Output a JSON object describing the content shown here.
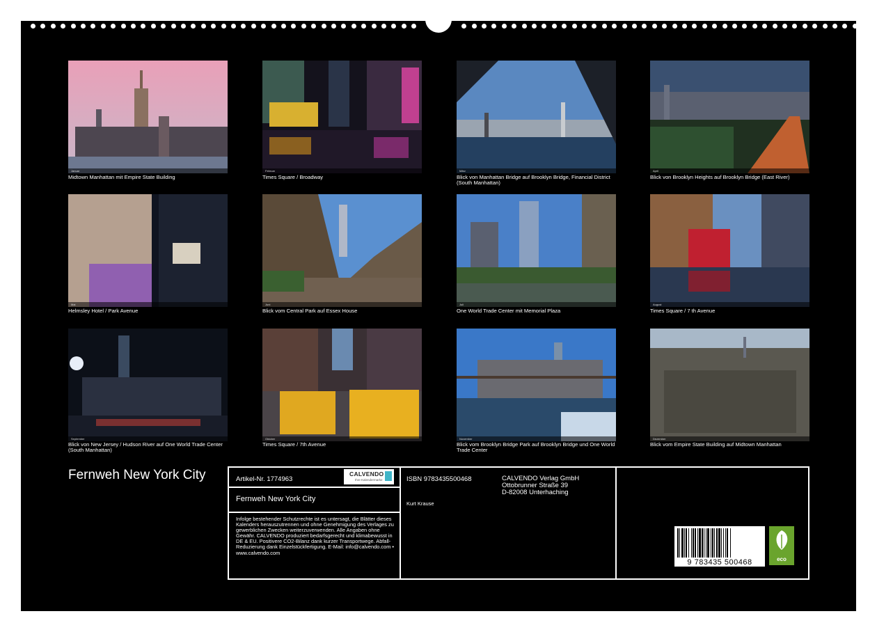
{
  "calendar": {
    "title": "Fernweh New York City",
    "photos": [
      {
        "caption": "Midtown Manhattan mit Empire State Building",
        "month": "Januar"
      },
      {
        "caption": "Times Square / Broadway",
        "month": "Februar"
      },
      {
        "caption": "Blick von Manhattan Bridge auf Brooklyn Bridge, Financial District (South Manhattan)",
        "month": "März"
      },
      {
        "caption": "Blick von Brooklyn Heights auf Brooklyn Bridge (East River)",
        "month": "April"
      },
      {
        "caption": "Helmsley  Hotel / Park Avenue",
        "month": "Mai"
      },
      {
        "caption": "Blick vom Central Park auf Essex House",
        "month": "Juni"
      },
      {
        "caption": "One World Trade Center mit Memorial Plaza",
        "month": "Juli"
      },
      {
        "caption": "Times Square / 7 th Avenue",
        "month": "August"
      },
      {
        "caption": "Blick von New Jersey / Hudson River auf One World Trade Center (South Manhattan)",
        "month": "September"
      },
      {
        "caption": "Times Square / 7th Avenue",
        "month": "Oktober"
      },
      {
        "caption": "Blick vom Brooklyn Bridge Park auf Brooklyn Bridge und One World Trade Center",
        "month": "November"
      },
      {
        "caption": "Blick vom Empire State Building auf Midtown Manhattan",
        "month": "Dezember"
      }
    ]
  },
  "info": {
    "article_label": "Artikel-Nr. 1774963",
    "product_title": "Fernweh New York City",
    "legal_text": "Infolge bestehender Schutzrechte ist es untersagt, die Blätter dieses Kalenders herauszutrennen und ohne Genehmigung des Verlages zu gewerblichen Zwecken weiterzuverwenden. Alle Angaben ohne Gewähr. CALVENDO produziert bedarfsgerecht und klimabewusst in DE & EU. Positivere CO2-Bilanz dank kurzer Transportwege. Abfall-Reduzierung dank Einzelstückfertigung. E-Mail: info@calvendo.com • www.calvendo.com",
    "isbn": "ISBN 9783435500468",
    "author": "Kurt Krause",
    "publisher_line1": "CALVENDO Verlag GmbH",
    "publisher_line2": "Ottobrunner Straße 39",
    "publisher_line3": "D-82008 Unterhaching",
    "logo_name": "CALVENDO",
    "logo_tagline": "Ihre Kalendermarke",
    "barcode_number": "9 783435 500468",
    "eco_label": "eco"
  }
}
